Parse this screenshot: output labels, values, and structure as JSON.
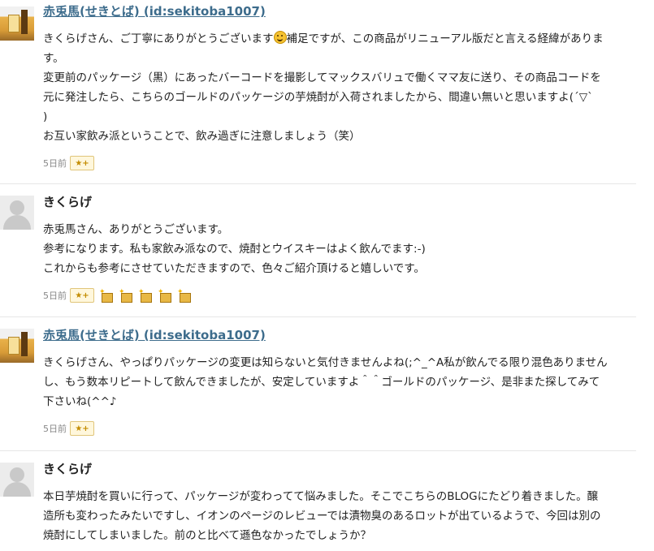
{
  "comments": [
    {
      "author": "赤兎馬(せきとば) (id:sekitoba1007)",
      "author_link": true,
      "avatar": "user-avatar",
      "text_before_emoji": "きくらげさん、ご丁寧にありがとうございます",
      "emoji": "smile-emoji",
      "text_after_emoji_line1": "補足ですが、この商品がリニューアル版だと言える経緯がありま",
      "lines": [
        "す。",
        "変更前のパッケージ（黒）にあったバーコードを撮影してマックスバリュで働くママ友に送り、その商品コードを",
        "元に発注したら、こちらのゴールドのパッケージの芋焼酎が入荷されましたから、間違い無いと思いますよ(ˊ▽ˋ",
        ")",
        "お互い家飲み派ということで、飲み過ぎに注意しましょう（笑）"
      ],
      "date": "5日前",
      "star_button": "★+",
      "stars_given": 0
    },
    {
      "author": "きくらげ",
      "author_link": false,
      "avatar": "default-avatar",
      "lines": [
        "赤兎馬さん、ありがとうございます。",
        "参考になります。私も家飲み派なので、焼酎とウイスキーはよく飲んでます:-)",
        "これからも参考にさせていただきますので、色々ご紹介頂けると嬉しいです。"
      ],
      "date": "5日前",
      "star_button": "★+",
      "stars_given": 5
    },
    {
      "author": "赤兎馬(せきとば) (id:sekitoba1007)",
      "author_link": true,
      "avatar": "user-avatar",
      "lines": [
        "きくらげさん、やっぱりパッケージの変更は知らないと気付きませんよね(;^_^A私が飲んでる限り混色ありません",
        "し、もう数本リピートして飲んできましたが、安定していますよ＾＾ゴールドのパッケージ、是非また探してみて",
        "下さいね(^^♪"
      ],
      "date": "5日前",
      "star_button": "★+",
      "stars_given": 0
    },
    {
      "author": "きくらげ",
      "author_link": false,
      "avatar": "default-avatar",
      "lines": [
        "本日芋焼酎を買いに行って、パッケージが変わってて悩みました。そこでこちらのBLOGにたどり着きました。醸",
        "造所も変わったみたいですし、イオンのページのレビューでは漬物臭のあるロットが出ているようで、今回は別の",
        "焼酎にしてしまいました。前のと比べて遜色なかったでしょうか？"
      ]
    }
  ]
}
